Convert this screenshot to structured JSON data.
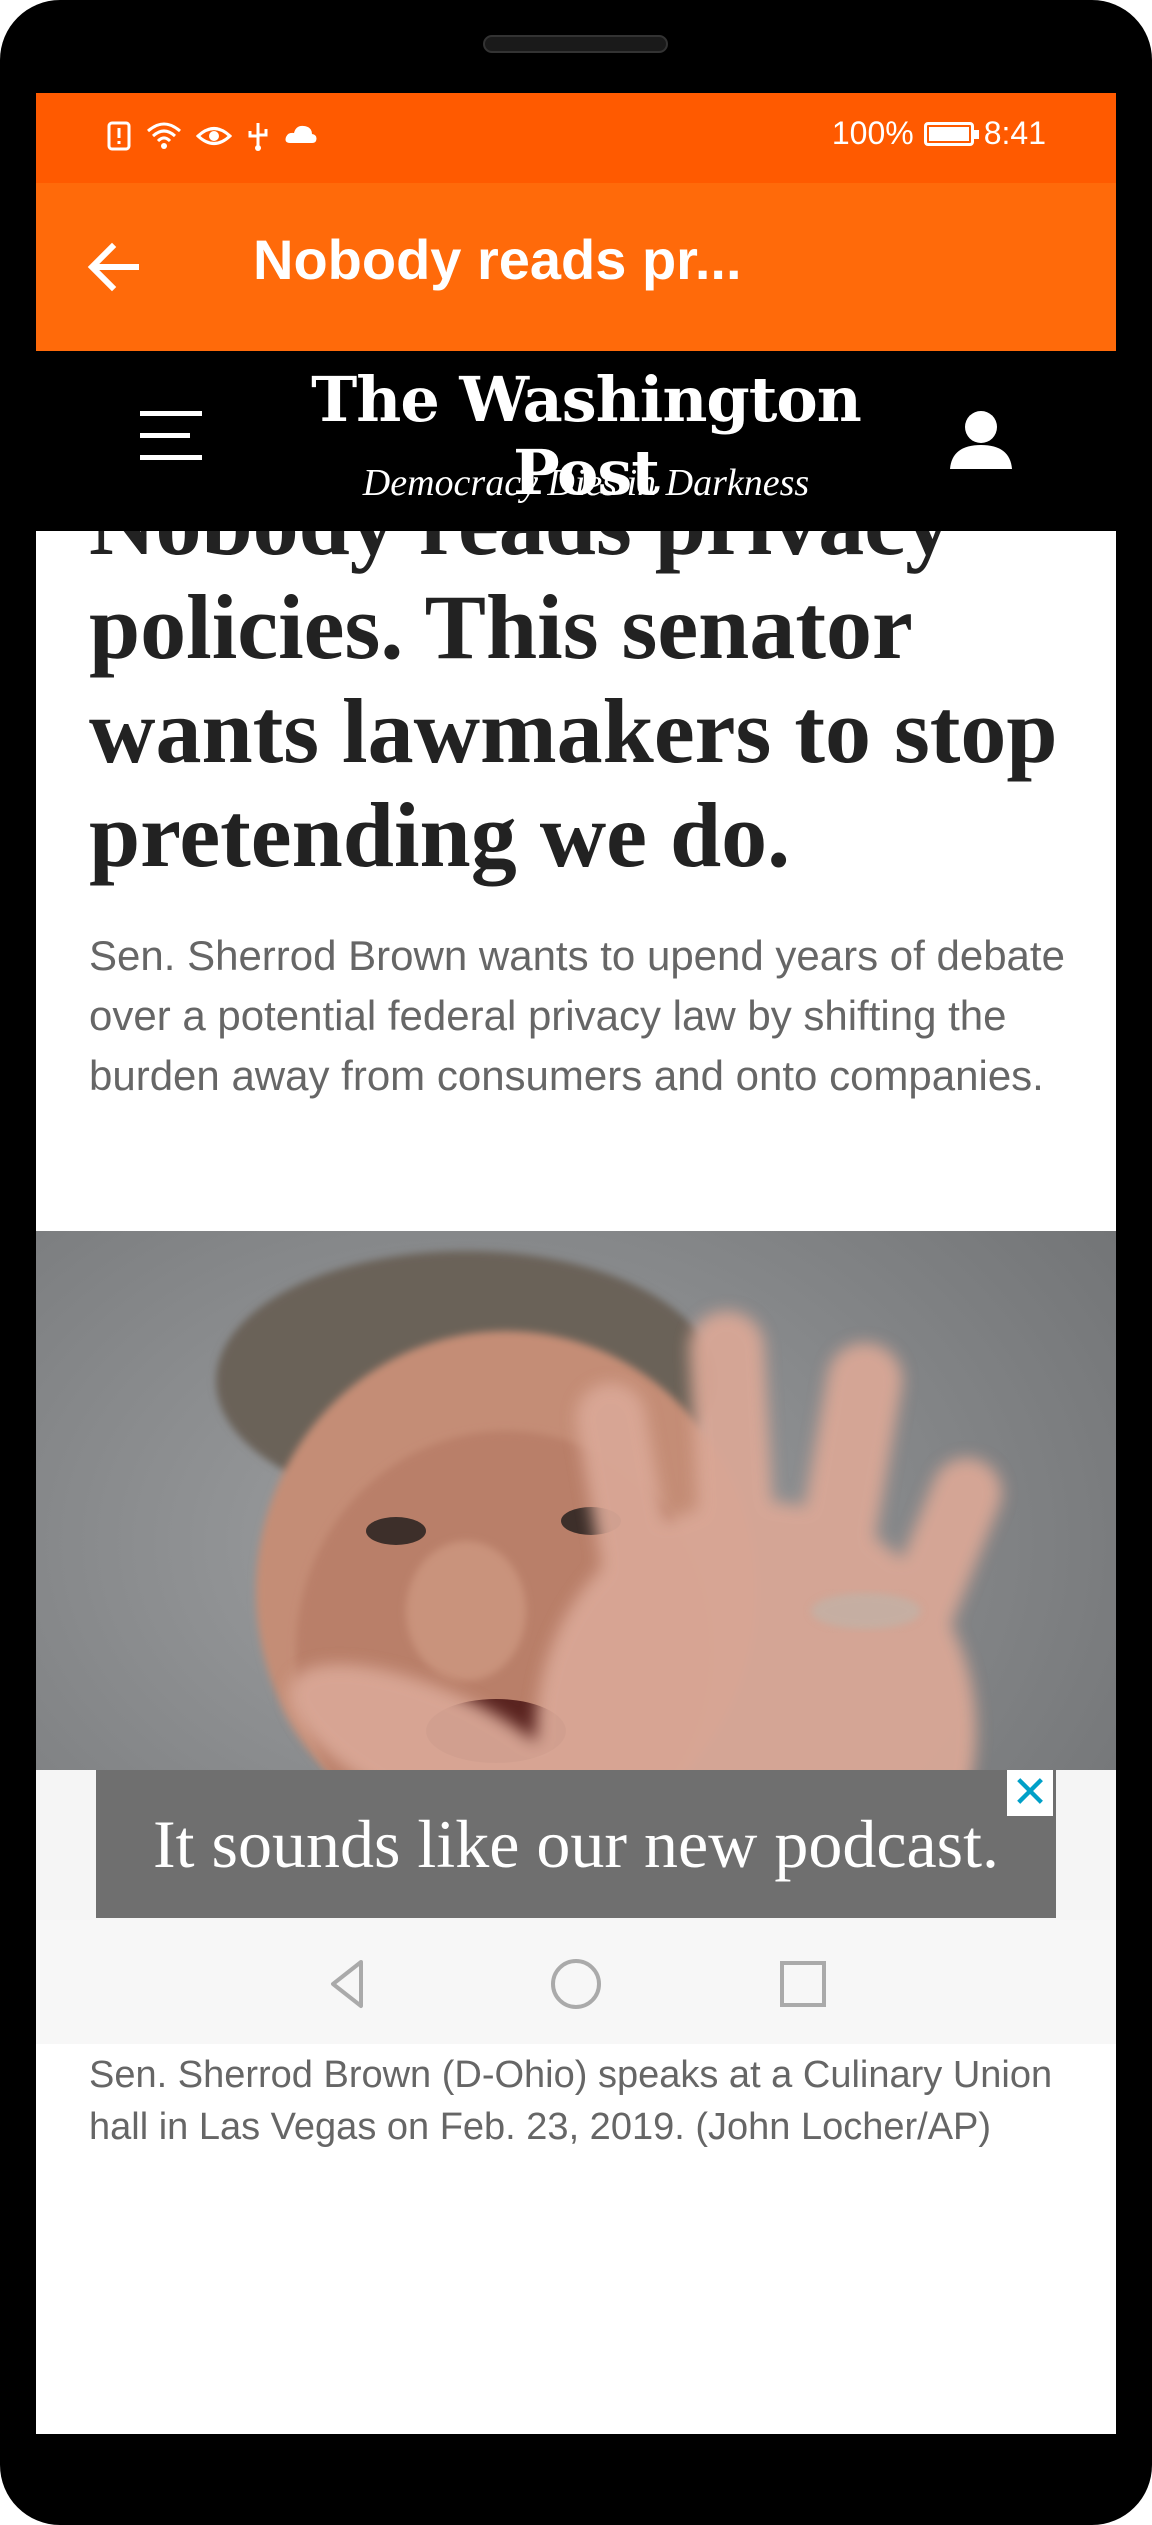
{
  "status_bar": {
    "battery_percent": "100%",
    "battery_level": 1.0,
    "time": "8:41",
    "icons": [
      "alert-icon",
      "wifi-icon",
      "eye-icon",
      "usb-icon",
      "cloud-icon"
    ]
  },
  "toolbar": {
    "title": "Nobody reads pr...",
    "back_icon": "arrow-left-icon",
    "color": "#ff6a0a"
  },
  "publication": {
    "masthead": "The Washington Post",
    "tagline": "Democracy Dies in Darkness",
    "menu_icon": "hamburger-menu-icon",
    "account_icon": "user-icon"
  },
  "article": {
    "headline": "Nobody reads privacy policies. This senator wants lawmakers to stop pretending we do.",
    "dek": "Sen. Sherrod Brown wants to upend years of debate over a potential federal privacy law by shifting the burden away from consumers and onto companies.",
    "caption": "Sen. Sherrod Brown (D-Ohio) speaks at a Culinary Union hall in Las Vegas on Feb. 23, 2019. (John Locher/AP)"
  },
  "ad": {
    "text": "It sounds like our new podcast.",
    "close_icon": "close-icon"
  },
  "nav": {
    "back_icon": "triangle-back-icon",
    "home_icon": "circle-home-icon",
    "recents_icon": "square-recents-icon"
  },
  "colors": {
    "status_bar": "#ff5a00",
    "toolbar": "#ff6a0a",
    "header": "#000000",
    "ad_close": "#00a0c8"
  }
}
